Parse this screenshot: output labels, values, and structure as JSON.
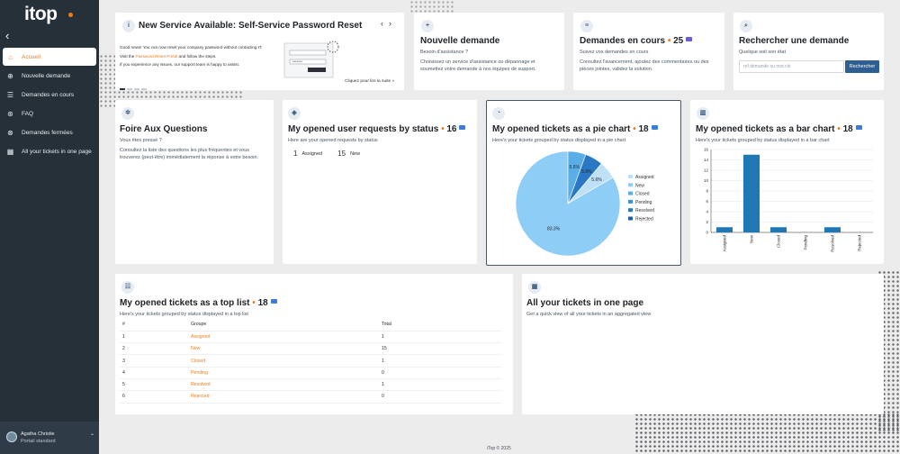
{
  "app": {
    "logo": "itop"
  },
  "sidebar": {
    "collapse_icon": "chevron-left-icon",
    "items": [
      {
        "label": "Accueil",
        "icon": "home-icon"
      },
      {
        "label": "Nouvelle demande",
        "icon": "plus-circle-icon"
      },
      {
        "label": "Demandes en cours",
        "icon": "chat-icon"
      },
      {
        "label": "FAQ",
        "icon": "help-icon"
      },
      {
        "label": "Demandes fermées",
        "icon": "close-circle-icon"
      },
      {
        "label": "All your tickets in one page",
        "icon": "grid-icon"
      }
    ],
    "user": {
      "name": "Agatha Christie",
      "portal": "Portail standard"
    }
  },
  "announcement": {
    "title": "New Service Available: Self-Service Password Reset",
    "line1": "Good news! You can now reset your company password without contacting IT.",
    "line2_pre": "Visit the ",
    "line2_link": "Password Reset Portal",
    "line2_post": " and follow the steps.",
    "line3": "If you experience any issues, our support team is happy to assist.",
    "more": "Cliquez pour lire la suite »",
    "prev": "‹",
    "next": "›"
  },
  "tiles": {
    "new_request": {
      "title": "Nouvelle demande",
      "sub": "Besoin d'assistance ?",
      "desc": "Choisissez un service d'assistance ou dépannage et soumettez votre demande à nos équipes de support."
    },
    "ongoing": {
      "title": "Demandes en cours",
      "count": "25",
      "sub": "Suivez vos demandes en cours",
      "desc": "Consultez l'avancement, ajoutez des commentaires ou des pièces jointes, validez la solution."
    },
    "search": {
      "title": "Rechercher une demande",
      "sub": "Quelque soit son état",
      "placeholder": "ref demande ou mot clé",
      "button": "Rechercher"
    },
    "faq": {
      "title": "Foire Aux Questions",
      "sub": "Vous êtes pressé ?",
      "desc": "Consultez la liste des questions les plus fréquentes et vous trouverez (peut-être) immédiatement la réponse à votre besoin."
    },
    "by_status": {
      "title": "My opened user requests by status",
      "count": "16",
      "sub": "Here are your opened requests by status",
      "items": [
        {
          "n": "1",
          "label": "Assigned"
        },
        {
          "n": "15",
          "label": "New"
        }
      ]
    },
    "pie": {
      "title": "My opened tickets as a pie chart",
      "count": "18",
      "sub": "Here's your tickets grouped by status displayed in a pie chart"
    },
    "bar": {
      "title": "My opened tickets as a bar chart",
      "count": "18",
      "sub": "Here's your tickets grouped by status displayed in a bar chart"
    },
    "toplist": {
      "title": "My opened tickets as a top list",
      "count": "18",
      "sub": "Here's your tickets grouped by status displayed in a top list",
      "headers": [
        "#",
        "Groupe",
        "Total"
      ],
      "rows": [
        [
          "1",
          "Assigned",
          "1"
        ],
        [
          "2",
          "New",
          "15"
        ],
        [
          "3",
          "Closed",
          "1"
        ],
        [
          "4",
          "Pending",
          "0"
        ],
        [
          "5",
          "Resolved",
          "1"
        ],
        [
          "6",
          "Rejected",
          "0"
        ]
      ]
    },
    "all": {
      "title": "All your tickets in one page",
      "sub": "Get a quick view of all your tickets in an aggregated view"
    }
  },
  "chart_data": [
    {
      "type": "pie",
      "categories": [
        "Assigned",
        "New",
        "Closed",
        "Pending",
        "Resolved",
        "Rejected"
      ],
      "values": [
        1,
        15,
        1,
        0,
        1,
        0
      ],
      "data_labels": [
        "5.6%",
        "83.3%",
        "5.6%",
        "",
        "5.6%",
        ""
      ],
      "colors": [
        "#bfe1f8",
        "#8ecdf5",
        "#5aaee8",
        "#3c8fd8",
        "#2a78c4",
        "#1f5fa8"
      ],
      "legend": "right"
    },
    {
      "type": "bar",
      "categories": [
        "Assigned",
        "New",
        "Closed",
        "Pending",
        "Resolved",
        "Rejected"
      ],
      "values": [
        1,
        15,
        1,
        0,
        1,
        0
      ],
      "ylim": [
        0,
        16
      ],
      "yticks": [
        0,
        2,
        4,
        6,
        8,
        10,
        12,
        14,
        16
      ],
      "grid": true,
      "color": "#1f77b4"
    }
  ],
  "footer": "iTop © 2025"
}
